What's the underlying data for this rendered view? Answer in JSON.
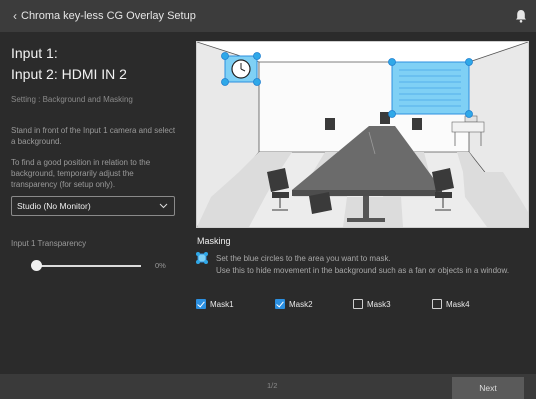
{
  "header": {
    "back_glyph": "‹",
    "title": "Chroma key-less CG Overlay Setup",
    "bell_icon": "bell-icon"
  },
  "left": {
    "input1": "Input 1:",
    "input2": "Input 2: HDMI IN 2",
    "setting": "Setting : Background and Masking",
    "instruction1": "Stand in front of the Input 1 camera and select a background.",
    "instruction2": "To find a good position in relation to the background, temporarily adjust the transparency (for setup only).",
    "background_select": "Studio (No Monitor)",
    "transparency_label": "Input 1 Transparency",
    "transparency_value": "0%",
    "transparency_fraction": 0
  },
  "masking": {
    "title": "Masking",
    "line1": "Set the blue circles to the area you want to mask.",
    "line2": "Use this to hide movement in the background such as a fan or objects in a window.",
    "checkboxes": [
      {
        "label": "Mask1",
        "checked": true
      },
      {
        "label": "Mask2",
        "checked": true
      },
      {
        "label": "Mask3",
        "checked": false
      },
      {
        "label": "Mask4",
        "checked": false
      }
    ]
  },
  "footer": {
    "page": "1/2",
    "next": "Next"
  },
  "colors": {
    "accent": "#2b8fe0",
    "mask_fill": "#7fd0f5",
    "background": "#2b2b2b",
    "header": "#3c3c3c"
  }
}
